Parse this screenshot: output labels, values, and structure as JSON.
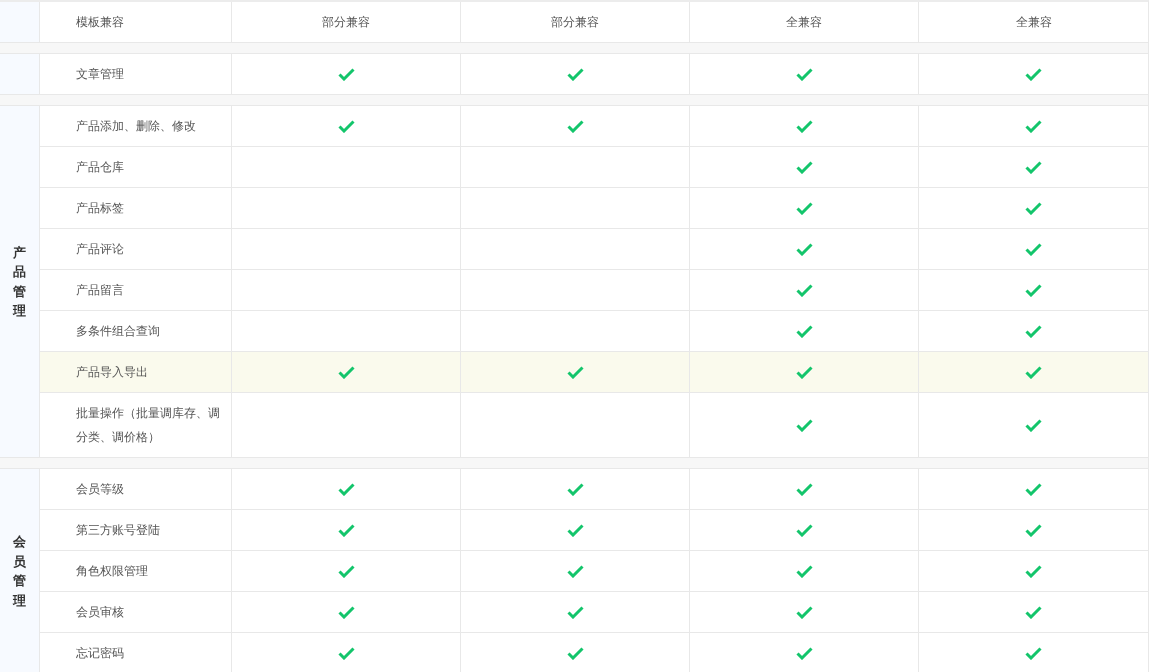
{
  "header": {
    "label": "模板兼容",
    "columns": [
      "部分兼容",
      "部分兼容",
      "全兼容",
      "全兼容"
    ]
  },
  "sections": [
    {
      "rows": [
        {
          "name": "文章管理",
          "highlighted": false,
          "checks": [
            true,
            true,
            true,
            true
          ]
        }
      ]
    },
    {
      "group": "产品管理",
      "rows": [
        {
          "name": "产品添加、删除、修改",
          "highlighted": false,
          "checks": [
            true,
            true,
            true,
            true
          ]
        },
        {
          "name": "产品仓库",
          "highlighted": false,
          "checks": [
            false,
            false,
            true,
            true
          ]
        },
        {
          "name": "产品标签",
          "highlighted": false,
          "checks": [
            false,
            false,
            true,
            true
          ]
        },
        {
          "name": "产品评论",
          "highlighted": false,
          "checks": [
            false,
            false,
            true,
            true
          ]
        },
        {
          "name": "产品留言",
          "highlighted": false,
          "checks": [
            false,
            false,
            true,
            true
          ]
        },
        {
          "name": "多条件组合查询",
          "highlighted": false,
          "checks": [
            false,
            false,
            true,
            true
          ]
        },
        {
          "name": "产品导入导出",
          "highlighted": true,
          "checks": [
            true,
            true,
            true,
            true
          ]
        },
        {
          "name": "批量操作（批量调库存、调分类、调价格）",
          "highlighted": false,
          "checks": [
            false,
            false,
            true,
            true
          ]
        }
      ]
    },
    {
      "group": "会员管理",
      "rows": [
        {
          "name": "会员等级",
          "highlighted": false,
          "checks": [
            true,
            true,
            true,
            true
          ]
        },
        {
          "name": "第三方账号登陆",
          "highlighted": false,
          "checks": [
            true,
            true,
            true,
            true
          ]
        },
        {
          "name": "角色权限管理",
          "highlighted": false,
          "checks": [
            true,
            true,
            true,
            true
          ]
        },
        {
          "name": "会员审核",
          "highlighted": false,
          "checks": [
            true,
            true,
            true,
            true
          ]
        },
        {
          "name": "忘记密码",
          "highlighted": false,
          "checks": [
            true,
            true,
            true,
            true
          ]
        }
      ]
    }
  ]
}
